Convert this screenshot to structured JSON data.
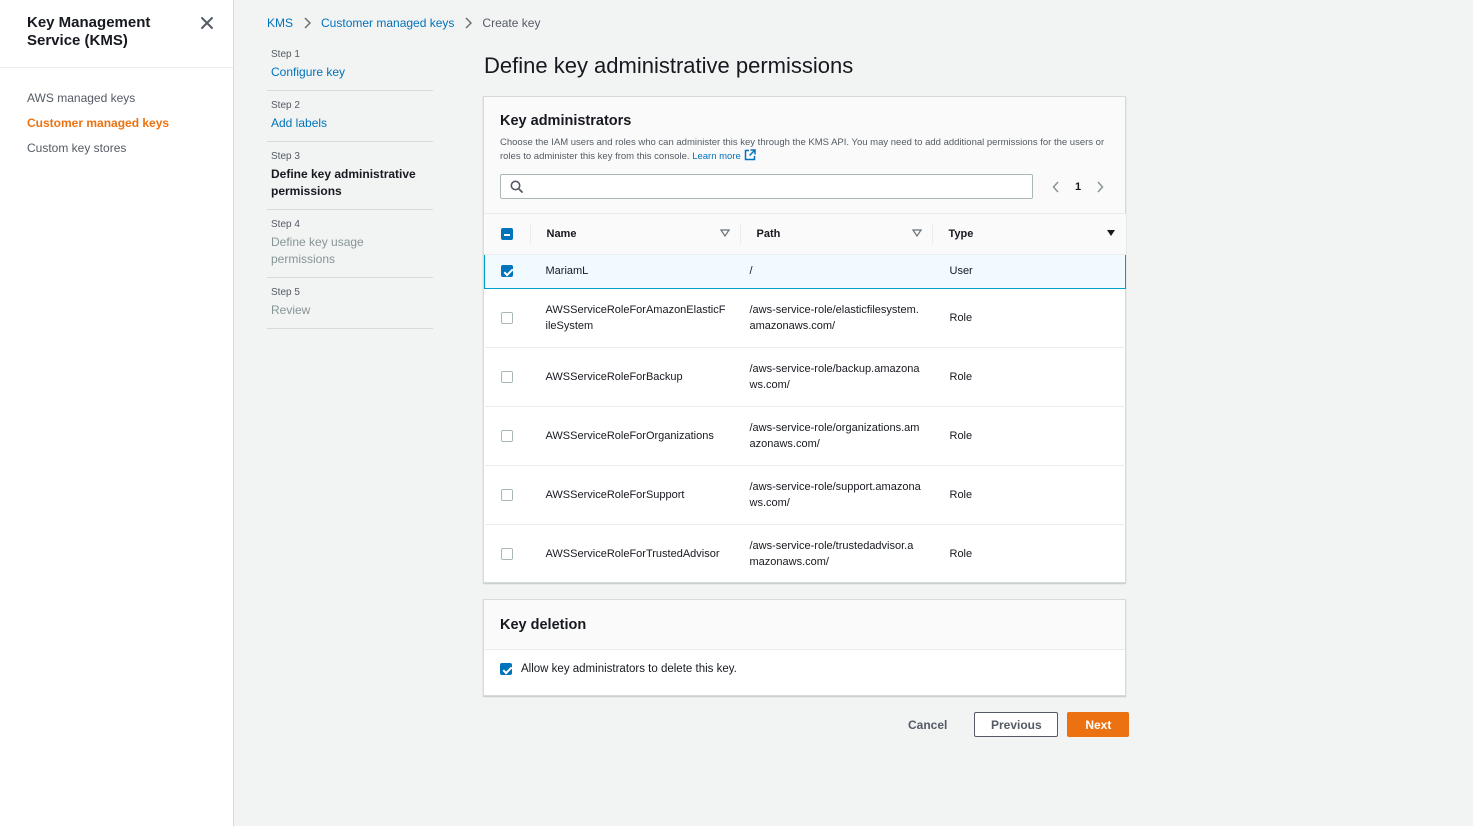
{
  "sidebar": {
    "title": "Key Management Service (KMS)",
    "items": [
      {
        "label": "AWS managed keys"
      },
      {
        "label": "Customer managed keys"
      },
      {
        "label": "Custom key stores"
      }
    ]
  },
  "breadcrumb": {
    "kms": "KMS",
    "customer_keys": "Customer managed keys",
    "current": "Create key"
  },
  "steps": [
    {
      "num": "Step 1",
      "title": "Configure key"
    },
    {
      "num": "Step 2",
      "title": "Add labels"
    },
    {
      "num": "Step 3",
      "title": "Define key administrative permissions"
    },
    {
      "num": "Step 4",
      "title": "Define key usage permissions"
    },
    {
      "num": "Step 5",
      "title": "Review"
    }
  ],
  "page_title": "Define key administrative permissions",
  "admins": {
    "title": "Key administrators",
    "description": "Choose the IAM users and roles who can administer this key through the KMS API. You may need to add additional permissions for the users or roles to administer this key from this console.",
    "learn_more": "Learn more",
    "search_placeholder": "",
    "page": "1",
    "columns": {
      "name": "Name",
      "path": "Path",
      "type": "Type"
    },
    "rows": [
      {
        "name": "MariamL",
        "path": "/",
        "type": "User",
        "checked": true
      },
      {
        "name": "AWSServiceRoleForAmazonElasticFileSystem",
        "path": "/aws-service-role/elasticfilesystem.amazonaws.com/",
        "type": "Role",
        "checked": false
      },
      {
        "name": "AWSServiceRoleForBackup",
        "path": "/aws-service-role/backup.amazonaws.com/",
        "type": "Role",
        "checked": false
      },
      {
        "name": "AWSServiceRoleForOrganizations",
        "path": "/aws-service-role/organizations.amazonaws.com/",
        "type": "Role",
        "checked": false
      },
      {
        "name": "AWSServiceRoleForSupport",
        "path": "/aws-service-role/support.amazonaws.com/",
        "type": "Role",
        "checked": false
      },
      {
        "name": "AWSServiceRoleForTrustedAdvisor",
        "path": "/aws-service-role/trustedadvisor.amazonaws.com/",
        "type": "Role",
        "checked": false
      }
    ]
  },
  "deletion": {
    "title": "Key deletion",
    "checkbox_label": "Allow key administrators to delete this key.",
    "checked": true
  },
  "footer": {
    "cancel": "Cancel",
    "previous": "Previous",
    "next": "Next"
  },
  "colors": {
    "accent": "#ec7211",
    "link": "#0073bb",
    "selected_border": "#00a1c9"
  }
}
